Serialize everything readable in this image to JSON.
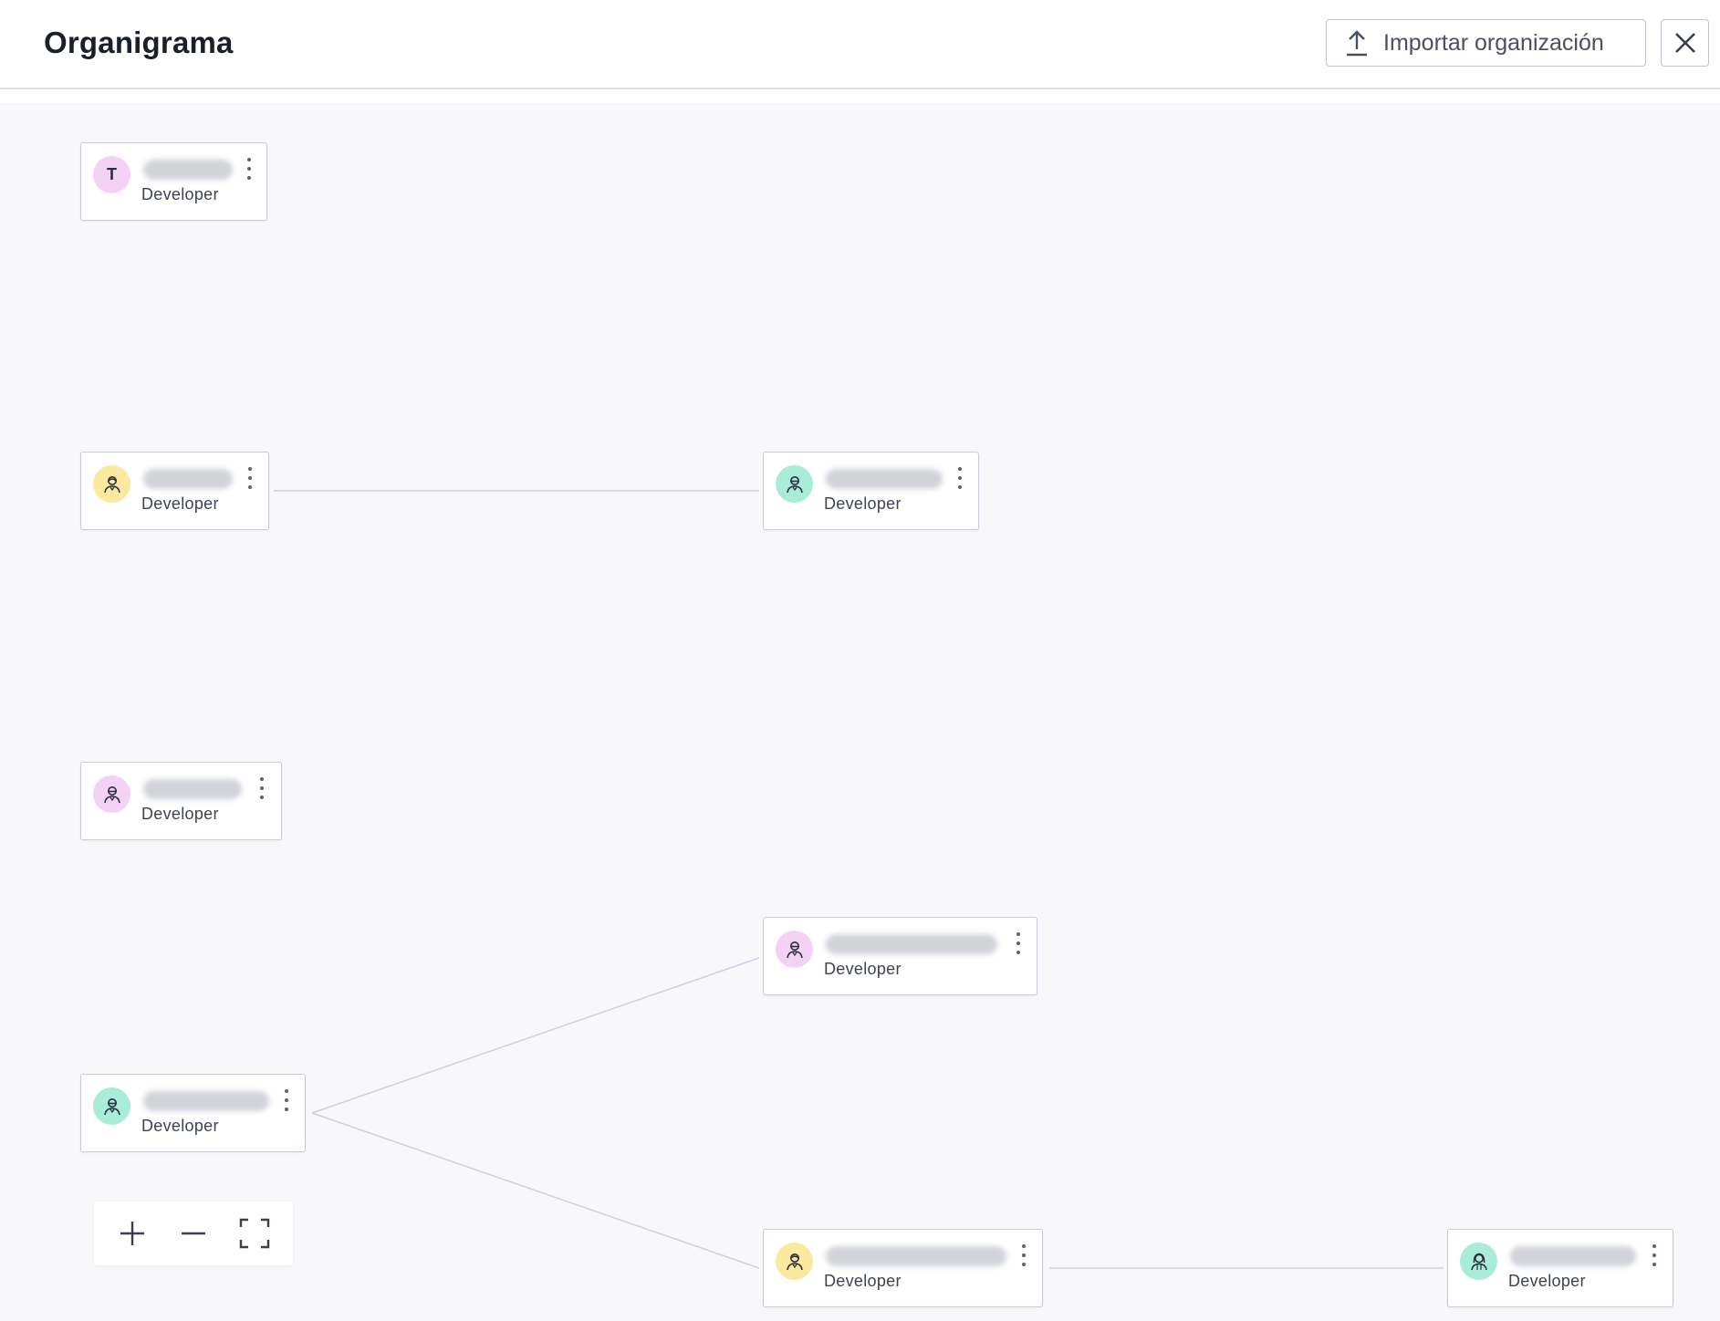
{
  "header": {
    "title": "Organigrama",
    "import_label": "Importar organización",
    "import_icon": "upload-icon",
    "close_icon": "close-icon"
  },
  "colors": {
    "pink": "#f4d2f6",
    "yellow": "#fbe9a0",
    "teal": "#a9ecd8",
    "line": "#cfcfe0",
    "canvas": "#f8f8fb"
  },
  "nodes": [
    {
      "id": "n1",
      "avatar_text": "T",
      "avatar_color": "pink",
      "avatar_icon": "initial",
      "role": "Developer"
    },
    {
      "id": "n2",
      "avatar_text": "",
      "avatar_color": "yellow",
      "avatar_icon": "user-icon",
      "role": "Developer"
    },
    {
      "id": "n3",
      "avatar_text": "",
      "avatar_color": "teal",
      "avatar_icon": "user-icon",
      "role": "Developer"
    },
    {
      "id": "n4",
      "avatar_text": "",
      "avatar_color": "pink",
      "avatar_icon": "user-icon",
      "role": "Developer"
    },
    {
      "id": "n5",
      "avatar_text": "",
      "avatar_color": "pink",
      "avatar_icon": "user-icon",
      "role": "Developer"
    },
    {
      "id": "n6",
      "avatar_text": "",
      "avatar_color": "teal",
      "avatar_icon": "user-icon",
      "role": "Developer"
    },
    {
      "id": "n7",
      "avatar_text": "",
      "avatar_color": "yellow",
      "avatar_icon": "user-icon",
      "role": "Developer"
    },
    {
      "id": "n8",
      "avatar_text": "",
      "avatar_color": "teal",
      "avatar_icon": "user-female-icon",
      "role": "Developer"
    }
  ],
  "edges": [
    [
      "n2",
      "n3"
    ],
    [
      "n6",
      "n5"
    ],
    [
      "n6",
      "n7"
    ],
    [
      "n7",
      "n8"
    ]
  ],
  "zoom_controls": {
    "zoom_in_icon": "plus-icon",
    "zoom_out_icon": "minus-icon",
    "fit_icon": "fullscreen-icon"
  }
}
